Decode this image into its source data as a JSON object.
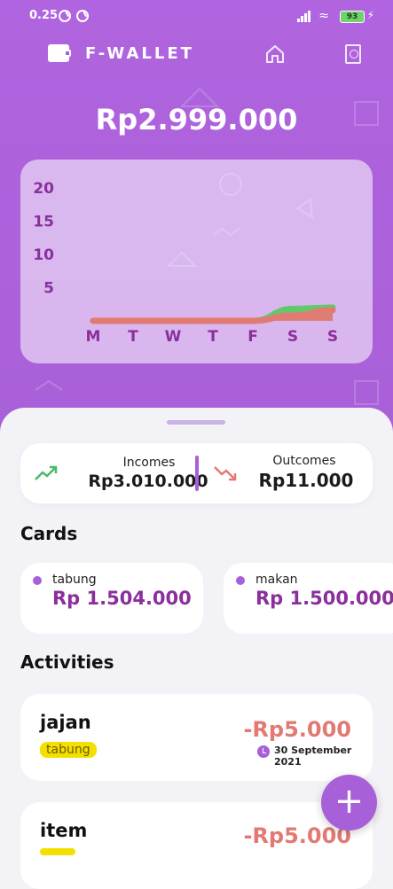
{
  "status_bar": {
    "time": "0.25",
    "battery": "93"
  },
  "app": {
    "title": "F-WALLET"
  },
  "balance": "Rp2.999.000",
  "chart_data": {
    "type": "area",
    "categories": [
      "M",
      "T",
      "W",
      "T",
      "F",
      "S",
      "S"
    ],
    "y_ticks": [
      "20",
      "15",
      "10",
      "5"
    ],
    "ylim": [
      0,
      20
    ],
    "series": [
      {
        "values": [
          0,
          0,
          0,
          0,
          0,
          1.8,
          2.0
        ],
        "color": "#63c86a"
      },
      {
        "values": [
          0,
          0,
          0,
          0,
          0,
          0.8,
          1.6
        ],
        "color": "#e27a73"
      }
    ]
  },
  "summary": {
    "incomes_label": "Incomes",
    "incomes_value": "Rp3.010.000",
    "outcomes_label": "Outcomes",
    "outcomes_value": "Rp11.000"
  },
  "cards_title": "Cards",
  "cards": [
    {
      "name": "tabung",
      "amount": "Rp 1.504.000"
    },
    {
      "name": "makan",
      "amount": "Rp 1.500.000"
    }
  ],
  "activities_title": "Activities",
  "activities": [
    {
      "title": "jajan",
      "tag": "tabung",
      "amount": "-Rp5.000",
      "date": "30 September 2021"
    },
    {
      "title": "item",
      "tag": "",
      "amount": "-Rp5.000",
      "date": ""
    }
  ],
  "fab": "+"
}
